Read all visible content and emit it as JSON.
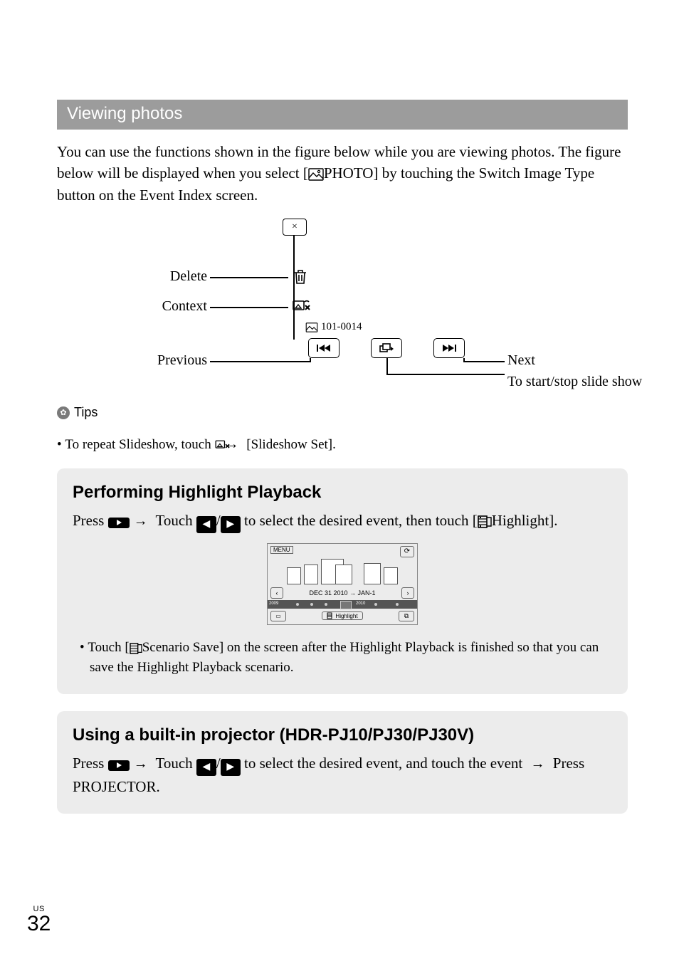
{
  "section_title": "Viewing photos",
  "intro_pre": "You can use the functions shown in the figure below while you are viewing photos. The figure below will be displayed when you select [",
  "intro_label": "PHOTO",
  "intro_post": "] by touching the Switch Image Type button on the Event Index screen.",
  "diagram": {
    "delete": "Delete",
    "context": "Context",
    "previous": "Previous",
    "next": "Next",
    "slideshow": "To start/stop slide show",
    "folder": "101-0014"
  },
  "tips_label": "Tips",
  "tips_bullet_pre": "To repeat Slideshow, touch ",
  "tips_bullet_post": " [Slideshow Set].",
  "highlight": {
    "title": "Performing Highlight Playback",
    "press": "Press ",
    "touch": " Touch ",
    "select": " to select the desired event, then touch [",
    "hl_label": "Highlight",
    "end": "].",
    "bullet_pre": "Touch [",
    "bullet_mid": "Scenario Save] on the screen after the Highlight Playback is finished so that you can save the Highlight Playback scenario."
  },
  "event_index": {
    "menu": "MENU",
    "date": "DEC 31 2010 → JAN-1",
    "year_left": "2009",
    "year_right": "2010",
    "highlight_btn": "Highlight"
  },
  "projector": {
    "title": "Using a built-in projector (HDR-PJ10/PJ30/PJ30V)",
    "press": "Press ",
    "touch": " Touch ",
    "select": " to select the desired event, and touch the event ",
    "press2": " Press PROJECTOR."
  },
  "page": {
    "region": "US",
    "number": "32"
  }
}
